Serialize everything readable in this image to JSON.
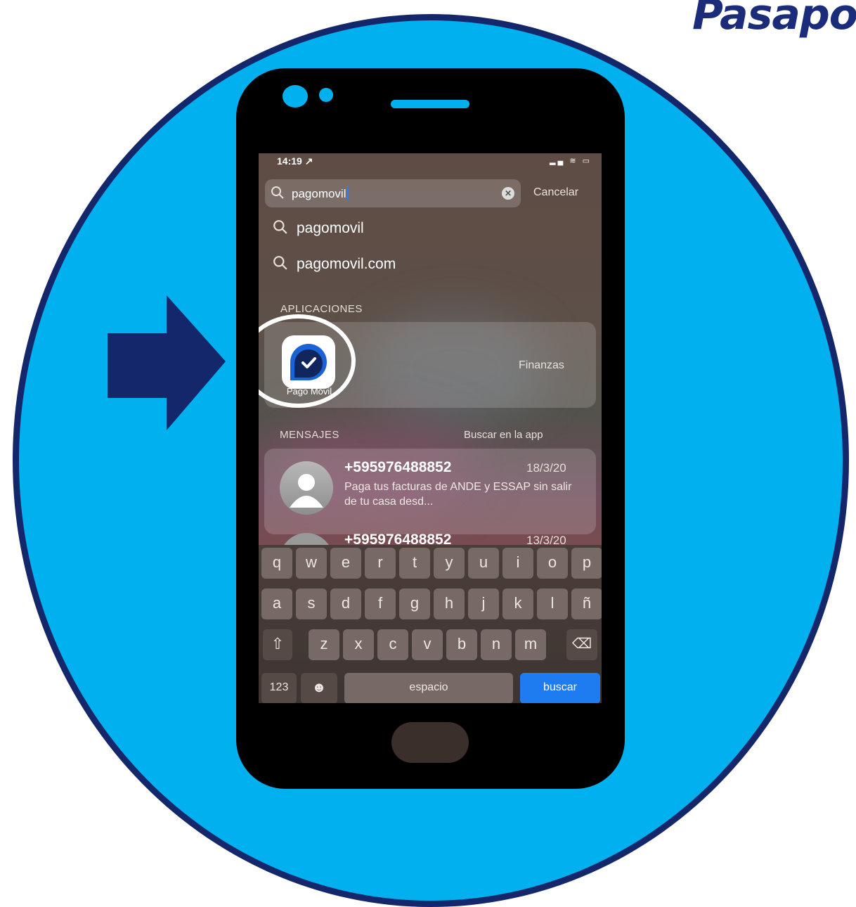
{
  "brand": {
    "text": "Pasapo"
  },
  "status_bar": {
    "time": "14:19 ↗",
    "icons": "▂▄ ≋ ▭"
  },
  "search": {
    "value": "pagomovil",
    "cancel_label": "Cancelar",
    "clear_glyph": "✕"
  },
  "suggestions": [
    {
      "label": "pagomovil"
    },
    {
      "label": "pagomovil.com"
    }
  ],
  "applications": {
    "section_label": "APLICACIONES",
    "app": {
      "name": "Pago Móvil",
      "category": "Finanzas",
      "icon": "check-bubble-icon"
    }
  },
  "messages": {
    "section_label": "MENSAJES",
    "link_label": "Buscar en la app",
    "items": [
      {
        "from": "+595976488852",
        "date": "18/3/20",
        "preview": "Paga tus facturas de ANDE y ESSAP sin salir de tu casa desd..."
      },
      {
        "from": "+595976488852",
        "date": "13/3/20"
      }
    ]
  },
  "keyboard": {
    "row1": [
      "q",
      "w",
      "e",
      "r",
      "t",
      "y",
      "u",
      "i",
      "o",
      "p"
    ],
    "row2": [
      "a",
      "s",
      "d",
      "f",
      "g",
      "h",
      "j",
      "k",
      "l",
      "ñ"
    ],
    "row3": [
      "z",
      "x",
      "c",
      "v",
      "b",
      "n",
      "m"
    ],
    "shift_glyph": "⇧",
    "delete_glyph": "⌫",
    "numbers_label": "123",
    "emoji_glyph": "☻",
    "space_label": "espacio",
    "search_label": "buscar"
  },
  "colors": {
    "circle": "#00b0ef",
    "circle_border": "#14276b",
    "brand": "#1b2d7a",
    "search_key": "#1f7cf0"
  }
}
